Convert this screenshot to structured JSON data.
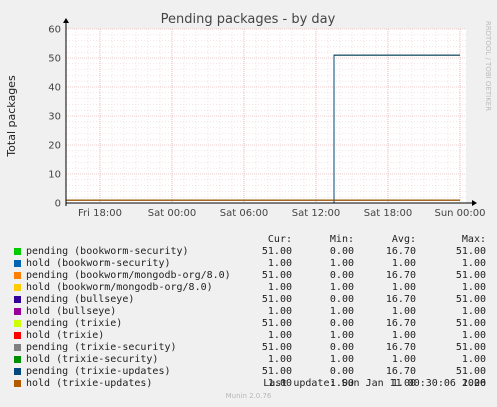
{
  "chart_data": {
    "type": "line",
    "title": "Pending packages - by day",
    "ylabel": "Total packages",
    "watermark": "RRDTOOL / TOBI OETIKER",
    "ylim": [
      0,
      60
    ],
    "yticks": [
      "0",
      "10",
      "20",
      "30",
      "40",
      "50",
      "60"
    ],
    "x_domain": [
      "Sat 2026-01-10 14:00",
      "Sun 2026-01-11 00:30"
    ],
    "xticks": [
      {
        "label": "Fri 18:00",
        "at": "Fri 2026-01-09 18:00"
      },
      {
        "label": "Sat 00:00",
        "at": "Sat 2026-01-10 00:00"
      },
      {
        "label": "Sat 06:00",
        "at": "Sat 2026-01-10 06:00"
      },
      {
        "label": "Sat 12:00",
        "at": "Sat 2026-01-10 12:00"
      },
      {
        "label": "Sat 18:00",
        "at": "Sat 2026-01-10 18:00"
      },
      {
        "label": "Sun 00:00",
        "at": "Sun 2026-01-11 00:00"
      }
    ],
    "series": [
      {
        "name": "pending (bookworm-security)",
        "color": "#00cc00",
        "x": [
          "Fri 18:00",
          "Sat 13:30",
          "Sat 13:30",
          "Sun 00:00"
        ],
        "values": [
          0,
          0,
          51,
          51
        ]
      },
      {
        "name": "hold (bookworm-security)",
        "color": "#0066b3",
        "x": [
          "Fri 18:00",
          "Sun 00:00"
        ],
        "values": [
          1,
          1
        ]
      },
      {
        "name": "pending (bookworm/mongodb-org/8.0)",
        "color": "#ff8000",
        "x": [
          "Fri 18:00",
          "Sat 13:30",
          "Sat 13:30",
          "Sun 00:00"
        ],
        "values": [
          0,
          0,
          51,
          51
        ]
      },
      {
        "name": "hold (bookworm/mongodb-org/8.0)",
        "color": "#ffcc00",
        "x": [
          "Fri 18:00",
          "Sun 00:00"
        ],
        "values": [
          1,
          1
        ]
      },
      {
        "name": "pending (bullseye)",
        "color": "#330099",
        "x": [
          "Fri 18:00",
          "Sat 13:30",
          "Sat 13:30",
          "Sun 00:00"
        ],
        "values": [
          0,
          0,
          51,
          51
        ]
      },
      {
        "name": "hold (bullseye)",
        "color": "#990099",
        "x": [
          "Fri 18:00",
          "Sun 00:00"
        ],
        "values": [
          1,
          1
        ]
      },
      {
        "name": "pending (trixie)",
        "color": "#ccff00",
        "x": [
          "Fri 18:00",
          "Sat 13:30",
          "Sat 13:30",
          "Sun 00:00"
        ],
        "values": [
          0,
          0,
          51,
          51
        ]
      },
      {
        "name": "hold (trixie)",
        "color": "#ff0000",
        "x": [
          "Fri 18:00",
          "Sun 00:00"
        ],
        "values": [
          1,
          1
        ]
      },
      {
        "name": "pending (trixie-security)",
        "color": "#808080",
        "x": [
          "Fri 18:00",
          "Sat 13:30",
          "Sat 13:30",
          "Sun 00:00"
        ],
        "values": [
          0,
          0,
          51,
          51
        ]
      },
      {
        "name": "hold (trixie-security)",
        "color": "#008f00",
        "x": [
          "Fri 18:00",
          "Sun 00:00"
        ],
        "values": [
          1,
          1
        ]
      },
      {
        "name": "pending (trixie-updates)",
        "color": "#00487d",
        "x": [
          "Fri 18:00",
          "Sat 13:30",
          "Sat 13:30",
          "Sun 00:00"
        ],
        "values": [
          0,
          0,
          51,
          51
        ]
      },
      {
        "name": "hold (trixie-updates)",
        "color": "#b35a00",
        "x": [
          "Fri 18:00",
          "Sun 00:00"
        ],
        "values": [
          1,
          1
        ]
      }
    ]
  },
  "legend": {
    "headers": {
      "cur": "Cur:",
      "min": "Min:",
      "avg": "Avg:",
      "max": "Max:"
    },
    "rows": [
      {
        "name": "pending (bookworm-security)",
        "color": "#00cc00",
        "cur": "51.00",
        "min": "0.00",
        "avg": "16.70",
        "max": "51.00"
      },
      {
        "name": "hold (bookworm-security)",
        "color": "#0066b3",
        "cur": "1.00",
        "min": "1.00",
        "avg": "1.00",
        "max": "1.00"
      },
      {
        "name": "pending (bookworm/mongodb-org/8.0)",
        "color": "#ff8000",
        "cur": "51.00",
        "min": "0.00",
        "avg": "16.70",
        "max": "51.00"
      },
      {
        "name": "hold (bookworm/mongodb-org/8.0)",
        "color": "#ffcc00",
        "cur": "1.00",
        "min": "1.00",
        "avg": "1.00",
        "max": "1.00"
      },
      {
        "name": "pending (bullseye)",
        "color": "#330099",
        "cur": "51.00",
        "min": "0.00",
        "avg": "16.70",
        "max": "51.00"
      },
      {
        "name": "hold (bullseye)",
        "color": "#990099",
        "cur": "1.00",
        "min": "1.00",
        "avg": "1.00",
        "max": "1.00"
      },
      {
        "name": "pending (trixie)",
        "color": "#ccff00",
        "cur": "51.00",
        "min": "0.00",
        "avg": "16.70",
        "max": "51.00"
      },
      {
        "name": "hold (trixie)",
        "color": "#ff0000",
        "cur": "1.00",
        "min": "1.00",
        "avg": "1.00",
        "max": "1.00"
      },
      {
        "name": "pending (trixie-security)",
        "color": "#808080",
        "cur": "51.00",
        "min": "0.00",
        "avg": "16.70",
        "max": "51.00"
      },
      {
        "name": "hold (trixie-security)",
        "color": "#008f00",
        "cur": "1.00",
        "min": "1.00",
        "avg": "1.00",
        "max": "1.00"
      },
      {
        "name": "pending (trixie-updates)",
        "color": "#00487d",
        "cur": "51.00",
        "min": "0.00",
        "avg": "16.70",
        "max": "51.00"
      },
      {
        "name": "hold (trixie-updates)",
        "color": "#b35a00",
        "cur": "1.00",
        "min": "1.00",
        "avg": "1.00",
        "max": "1.00"
      }
    ]
  },
  "footer": {
    "last_update": "Last update: Sun Jan 11 00:30:06 2026",
    "version": "Munin 2.0.76"
  }
}
